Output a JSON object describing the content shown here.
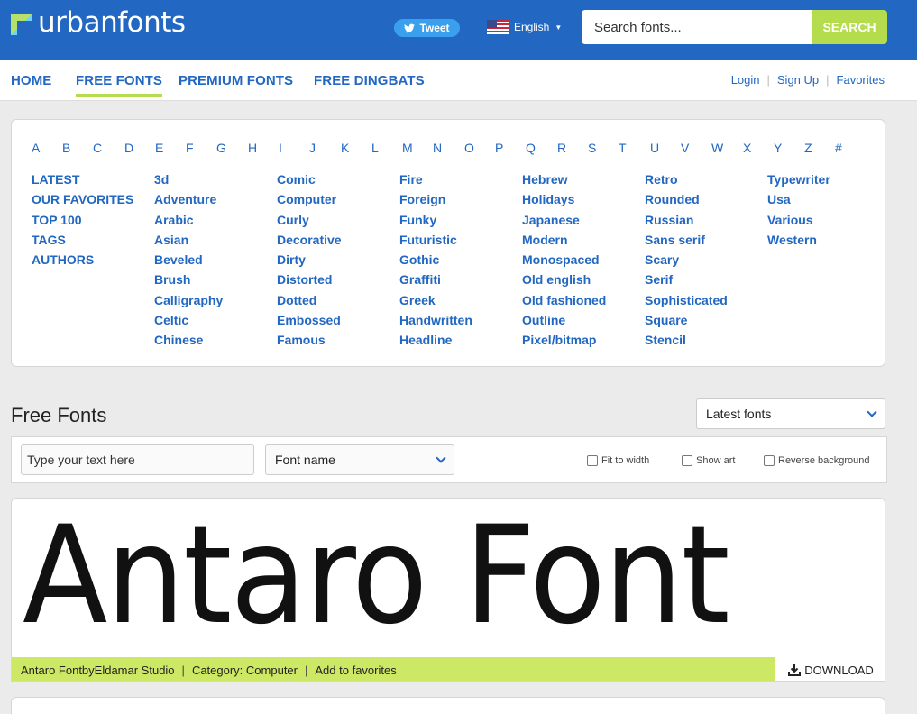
{
  "header": {
    "logo_text": "urbanfonts",
    "tweet_label": "Tweet",
    "language": "English",
    "search_placeholder": "Search fonts...",
    "search_button": "SEARCH"
  },
  "nav": {
    "items": [
      "HOME",
      "FREE FONTS",
      "PREMIUM FONTS",
      "FREE DINGBATS"
    ],
    "active": "FREE FONTS",
    "login": "Login",
    "signup": "Sign Up",
    "favorites": "Favorites",
    "sep": "|"
  },
  "alphabet": [
    "A",
    "B",
    "C",
    "D",
    "E",
    "F",
    "G",
    "H",
    "I",
    "J",
    "K",
    "L",
    "M",
    "N",
    "O",
    "P",
    "Q",
    "R",
    "S",
    "T",
    "U",
    "V",
    "W",
    "X",
    "Y",
    "Z",
    "#"
  ],
  "categories": {
    "col1": [
      "LATEST",
      "OUR FAVORITES",
      "TOP 100",
      "TAGS",
      "AUTHORS"
    ],
    "col2": [
      "3d",
      "Adventure",
      "Arabic",
      "Asian",
      "Beveled",
      "Brush",
      "Calligraphy",
      "Celtic",
      "Chinese"
    ],
    "col3": [
      "Comic",
      "Computer",
      "Curly",
      "Decorative",
      "Dirty",
      "Distorted",
      "Dotted",
      "Embossed",
      "Famous"
    ],
    "col4": [
      "Fire",
      "Foreign",
      "Funky",
      "Futuristic",
      "Gothic",
      "Graffiti",
      "Greek",
      "Handwritten",
      "Headline"
    ],
    "col5": [
      "Hebrew",
      "Holidays",
      "Japanese",
      "Modern",
      "Monospaced",
      "Old english",
      "Old fashioned",
      "Outline",
      "Pixel/bitmap"
    ],
    "col6": [
      "Retro",
      "Rounded",
      "Russian",
      "Sans serif",
      "Scary",
      "Serif",
      "Sophisticated",
      "Square",
      "Stencil"
    ],
    "col7": [
      "Typewriter",
      "Usa",
      "Various",
      "Western"
    ]
  },
  "section": {
    "title": "Free Fonts",
    "sort_value": "Latest fonts"
  },
  "toolbar": {
    "text_placeholder": "Type your text here",
    "font_select": "Font name",
    "fit_to_width": "Fit to width",
    "show_art": "Show art",
    "reverse_bg": "Reverse background"
  },
  "font_card": {
    "preview_text": "Antaro Font",
    "name_author": "Antaro FontbyEldamar Studio",
    "category": "Category: Computer",
    "add_fav": "Add to favorites",
    "pipe": "|",
    "download": "DOWNLOAD"
  },
  "colors": {
    "brand_blue": "#2267c1",
    "accent_green": "#b4dc4c",
    "card_bar_green": "#cce864"
  }
}
